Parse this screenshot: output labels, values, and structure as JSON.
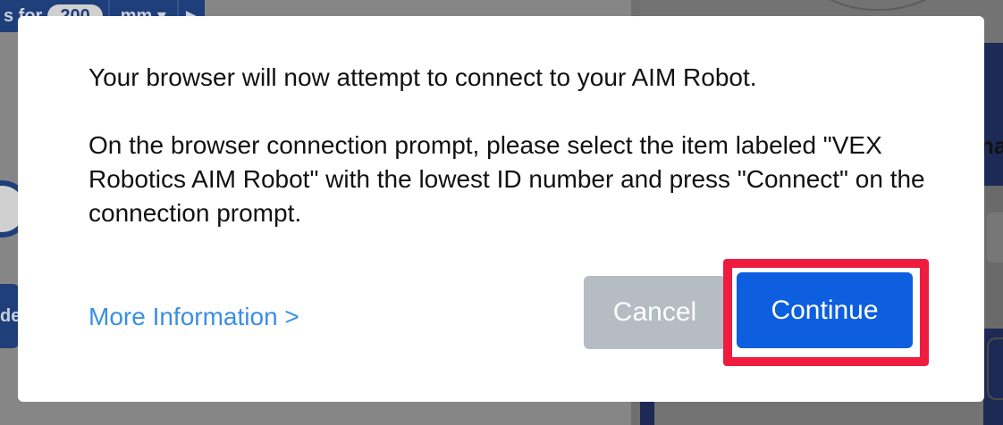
{
  "background": {
    "block_prefix": "s for",
    "distance_value": "200",
    "unit_dropdown": "mm",
    "side_chip_text": "de",
    "panel_heading_fragment": "na",
    "panel_button_fragment": "C"
  },
  "dialog": {
    "message_1": "Your browser will now attempt to connect to your AIM Robot.",
    "message_2": "On the browser connection prompt, please select the item labeled \"VEX Robotics AIM Robot\" with the lowest ID number and press \"Connect\" on the connection prompt.",
    "more_info_link": "More Information >",
    "cancel_label": "Cancel",
    "continue_label": "Continue"
  },
  "colors": {
    "primary_button": "#0d5fe0",
    "secondary_button": "#b5bcc3",
    "link": "#3a8ee6",
    "highlight_box": "#ee1c3e"
  },
  "icons": [
    "dropdown-caret-icon",
    "play-arrow-icon"
  ]
}
